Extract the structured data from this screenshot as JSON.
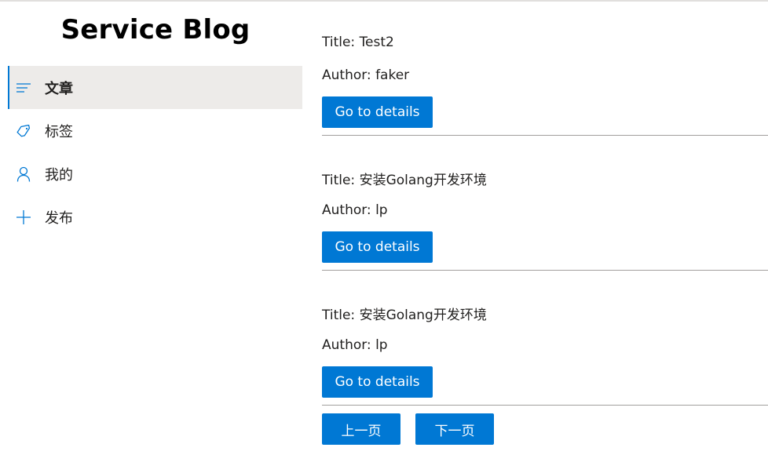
{
  "sidebar": {
    "title": "Service Blog",
    "items": [
      {
        "label": "文章",
        "icon": "article-list-icon",
        "active": true
      },
      {
        "label": "标签",
        "icon": "tag-icon",
        "active": false
      },
      {
        "label": "我的",
        "icon": "person-icon",
        "active": false
      },
      {
        "label": "发布",
        "icon": "add-icon",
        "active": false
      }
    ]
  },
  "posts": [
    {
      "title": "Title: Test2",
      "author": "Author: faker",
      "button": "Go to details"
    },
    {
      "title": "Title: 安装Golang开发环境",
      "author": "Author: lp",
      "button": "Go to details"
    },
    {
      "title": "Title: 安装Golang开发环境",
      "author": "Author: lp",
      "button": "Go to details"
    }
  ],
  "pagination": {
    "prev_label": "上一页",
    "next_label": "下一页"
  },
  "colors": {
    "accent": "#0078d4",
    "active_bg": "#edebe9",
    "divider": "#a19f9d"
  }
}
